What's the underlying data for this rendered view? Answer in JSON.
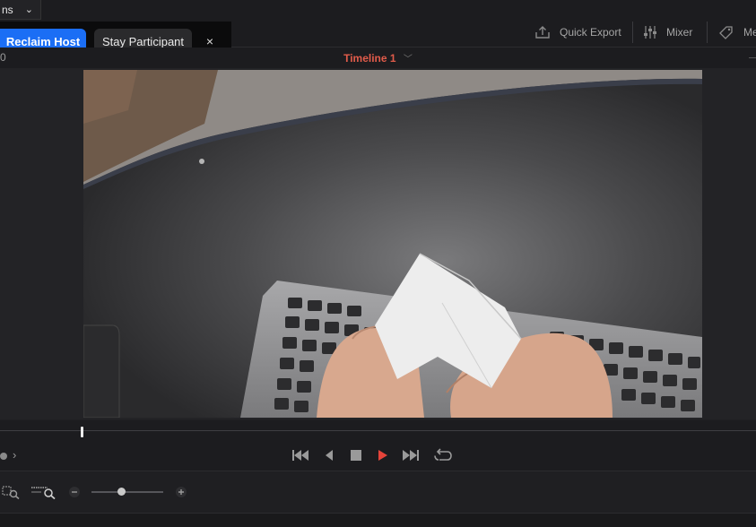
{
  "zoom_menu": {
    "label": "ns",
    "chevron_icon": "chevron-down-icon"
  },
  "host_popup": {
    "reclaim_label": "Reclaim Host",
    "stay_label": "Stay Participant",
    "close_label": "×"
  },
  "toolbar": {
    "quick_export_label": "Quick Export",
    "mixer_label": "Mixer",
    "metadata_label": "Me"
  },
  "viewer": {
    "timecode_fragment": "0",
    "timeline_name": "Timeline 1"
  },
  "transport": {
    "icons": [
      "skip-to-start-icon",
      "step-back-icon",
      "stop-icon",
      "play-icon",
      "skip-to-end-icon",
      "loop-icon"
    ]
  },
  "zoom_controls": {
    "icons": [
      "zoom-fit-icon",
      "zoom-detail-icon",
      "zoom-out-icon",
      "zoom-in-icon"
    ]
  },
  "colors": {
    "accent_blue": "#1b6ef5",
    "timeline_red": "#e05b4a",
    "play_red": "#e5443a"
  }
}
